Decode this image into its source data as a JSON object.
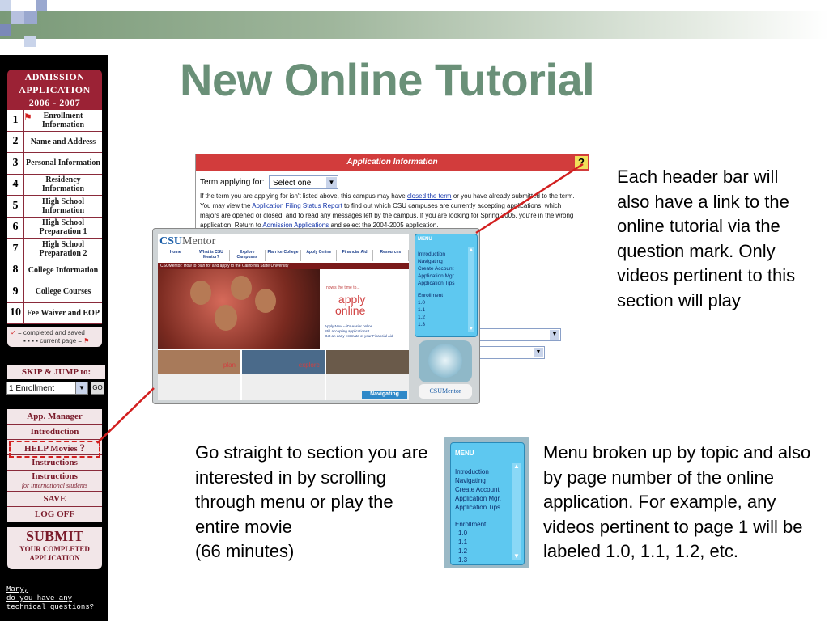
{
  "slide": {
    "title": "New Online Tutorial",
    "text_header": "Each header bar will also have a link to the online tutorial via the question mark. Only videos pertinent to this section will play",
    "text_go_line1": "Go straight to section you are interested in by scrolling through menu or play the entire movie",
    "text_go_line2": "(66 minutes)",
    "text_menu": "Menu broken up by topic and also by page number of the online application.  For example, any videos pertinent to page 1 will be labeled 1.0, 1.1, 1.2, etc."
  },
  "colors": {
    "title": "#6a9078",
    "accent_red": "#d21f1f",
    "sidebar_header": "#9b2235",
    "menu_blue": "#5ec8f0"
  },
  "sidebar": {
    "header": [
      "ADMISSION",
      "APPLICATION",
      "2006 - 2007"
    ],
    "steps": [
      {
        "num": "1",
        "label": "Enrollment Information"
      },
      {
        "num": "2",
        "label": "Name and Address"
      },
      {
        "num": "3",
        "label": "Personal Information"
      },
      {
        "num": "4",
        "label": "Residency Information"
      },
      {
        "num": "5",
        "label": "High School Information"
      },
      {
        "num": "6",
        "label": "High School Preparation 1"
      },
      {
        "num": "7",
        "label": "High School Preparation 2"
      },
      {
        "num": "8",
        "label": "College Information"
      },
      {
        "num": "9",
        "label": "College Courses"
      },
      {
        "num": "10",
        "label": "Fee Waiver and EOP"
      }
    ],
    "legend_completed": "= completed and saved",
    "legend_current": "current page =",
    "skip_label": "SKIP & JUMP to:",
    "skip_value": "1 Enrollment",
    "go_label": "GO",
    "menu": [
      "App. Manager",
      "Introduction",
      "HELP Movies",
      "Instructions",
      "Instructions",
      "SAVE",
      "LOG OFF"
    ],
    "instructions_sub": "for international students",
    "submit_big": "SUBMIT",
    "submit_line1": "YOUR COMPLETED",
    "submit_line2": "APPLICATION",
    "mary_line1": "Mary,",
    "mary_line2": "do you have any",
    "mary_line3": "technical questions?"
  },
  "app_info": {
    "header": "Application Information",
    "help_icon_label": "?",
    "term_label": "Term applying for:",
    "term_value": "Select one",
    "para_1": "If the term you are applying for isn't listed above, this campus may have",
    "link_1": "closed the term",
    "para_2": "or you have already submitted to the term. You may view the",
    "link_2": "Application Filing Status Report",
    "para_3": "to find out which CSU campuses are currently accepting applications, which majors are opened or closed, and to read any messages left by the campus. If you are looking for Spring 2005, you're in the wrong application. Return to",
    "link_3": "Admission Applications",
    "para_4": "and select the 2004-2005 application."
  },
  "csu_mentor": {
    "logo_csu": "CSU",
    "logo_mentor": "Mentor",
    "nav": [
      "Home",
      "What is CSU Mentor?",
      "Explore Campuses",
      "Plan for College",
      "Apply Online",
      "Financial Aid",
      "Resources"
    ],
    "strip": "CSUMentor: How to plan for and apply to the California State University",
    "now_time": "now's the time to...",
    "apply": "apply",
    "online": "online",
    "bullets": [
      "Apply Now -- it's easier online",
      "Still accepting applications?",
      "Get an early estimate of your Financial Aid"
    ],
    "bottom_words": [
      "plan",
      "explore",
      ""
    ],
    "navigating": "Navigating",
    "menu_header": "MENU",
    "menu_items": [
      "Introduction",
      "Navigating",
      "Create Account",
      "Application Mgr.",
      "Application Tips",
      "",
      "Enrollment",
      " 1.0",
      " 1.1",
      " 1.2",
      " 1.3"
    ],
    "foot_logo": "CSUMentor"
  },
  "menu_image": {
    "header": "MENU",
    "items": [
      "Introduction",
      "Navigating",
      "Create Account",
      "Application Mgr.",
      "Application Tips",
      "",
      "Enrollment",
      " 1.0",
      " 1.1",
      " 1.2",
      " 1.3"
    ]
  }
}
